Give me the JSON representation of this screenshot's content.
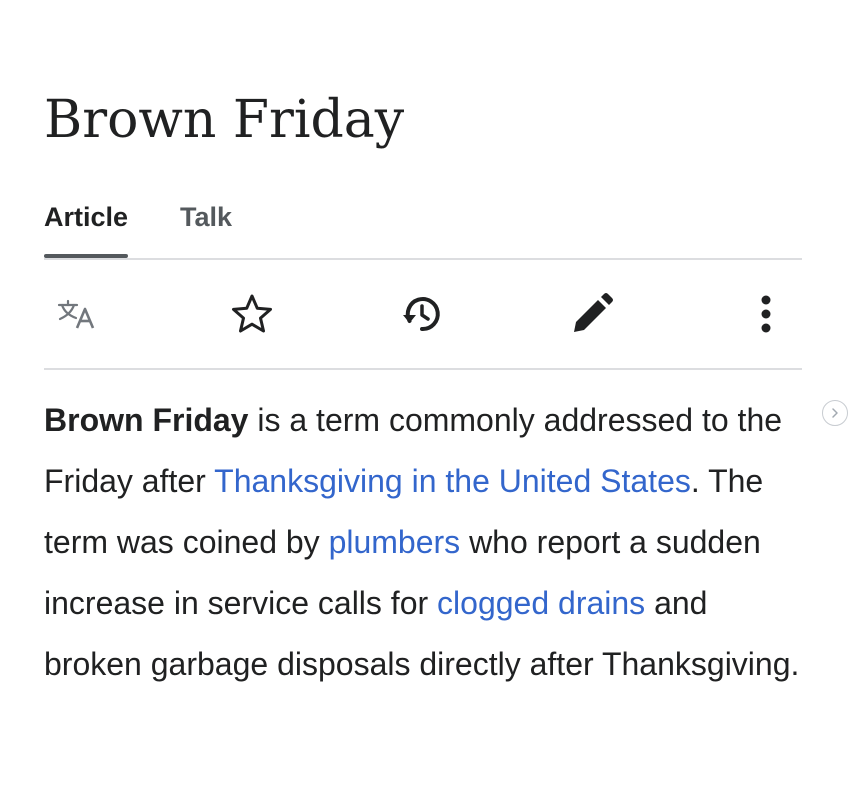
{
  "page": {
    "title": "Brown Friday"
  },
  "tabs": [
    {
      "label": "Article",
      "active": true
    },
    {
      "label": "Talk",
      "active": false
    }
  ],
  "toolbar": {
    "icons": [
      "language-icon",
      "star-icon",
      "history-icon",
      "edit-icon",
      "more-icon"
    ]
  },
  "article": {
    "bold_term": "Brown Friday",
    "text_1": " is a term commonly addressed to the Friday after ",
    "link_1": "Thanksgiving in the United States",
    "text_2": ". The term was coined by ",
    "link_2": "plumbers",
    "text_3": " who report a sudden increase in service calls for ",
    "link_3": "clogged drains",
    "text_4": " and broken garbage disposals directly after Thanksgiving."
  },
  "colors": {
    "link": "#3366cc",
    "text": "#202122",
    "icon": "#202122",
    "disabled_icon": "#72777d",
    "divider": "#dcdde0"
  }
}
